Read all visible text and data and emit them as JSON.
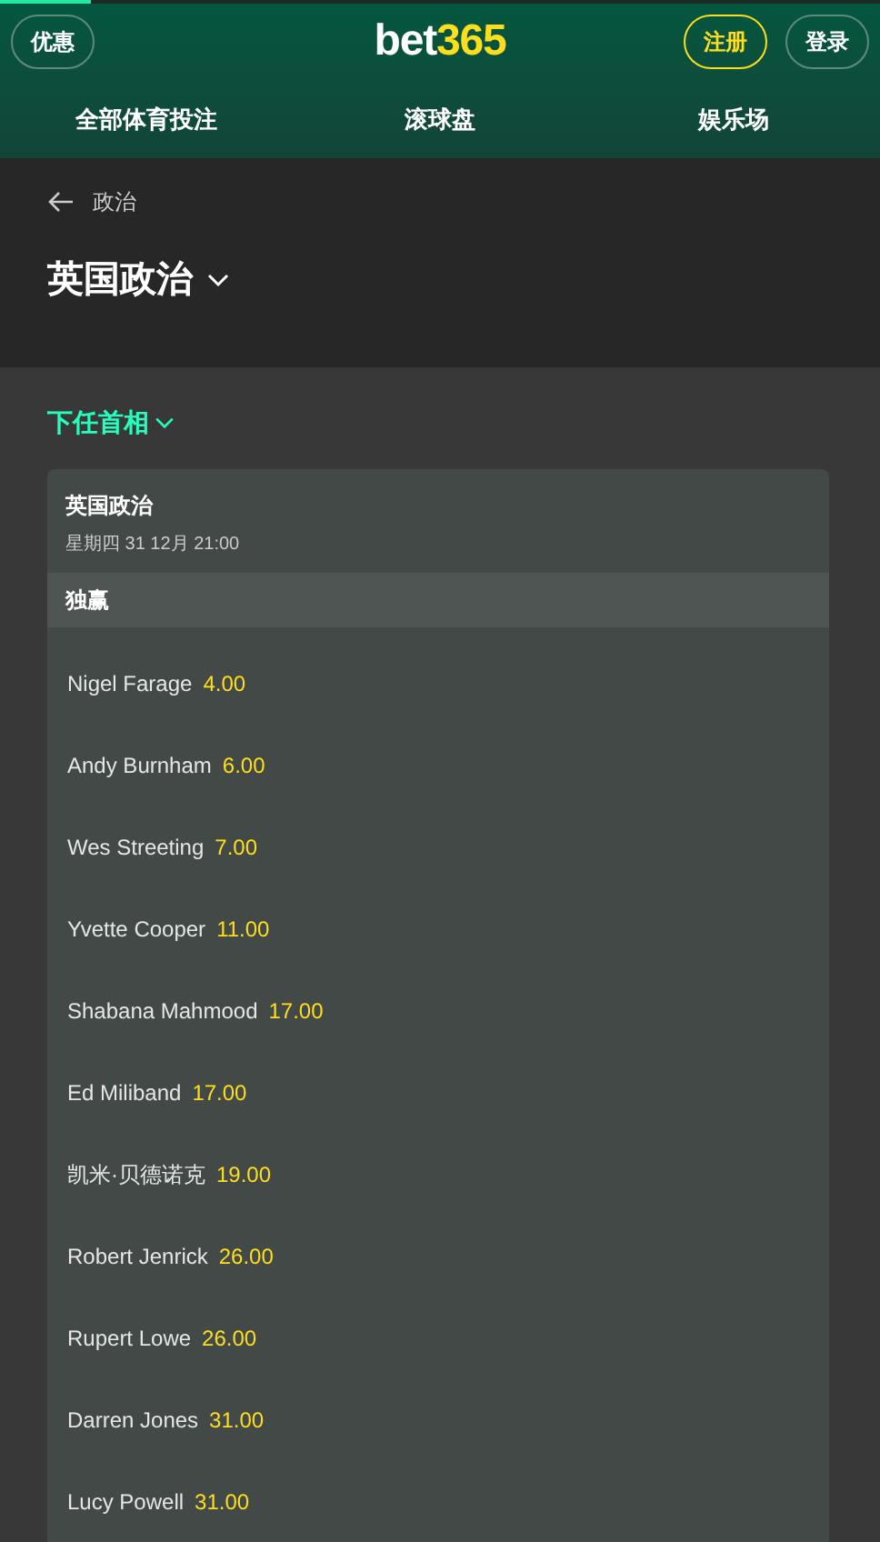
{
  "header": {
    "promo_button": "优惠",
    "logo": {
      "part_1": "bet",
      "part_2": "365"
    },
    "register_button": "注册",
    "login_button": "登录"
  },
  "nav": [
    {
      "label": "全部体育投注"
    },
    {
      "label": "滚球盘"
    },
    {
      "label": "娱乐场"
    }
  ],
  "breadcrumb": {
    "label": "政治"
  },
  "page_title": "英国政治",
  "market_selector": "下任首相",
  "event": {
    "title": "英国政治",
    "date": "星期四 31 12月 21:00",
    "market": "独赢",
    "selections": [
      {
        "name": "Nigel Farage",
        "odds": "4.00"
      },
      {
        "name": "Andy Burnham",
        "odds": "6.00"
      },
      {
        "name": "Wes Streeting",
        "odds": "7.00"
      },
      {
        "name": "Yvette Cooper",
        "odds": "11.00"
      },
      {
        "name": "Shabana Mahmood",
        "odds": "17.00"
      },
      {
        "name": "Ed Miliband",
        "odds": "17.00"
      },
      {
        "name": "凯米·贝德诺克",
        "odds": "19.00"
      },
      {
        "name": "Robert Jenrick",
        "odds": "26.00"
      },
      {
        "name": "Rupert Lowe",
        "odds": "26.00"
      },
      {
        "name": "Darren Jones",
        "odds": "31.00"
      },
      {
        "name": "Lucy Powell",
        "odds": "31.00"
      }
    ]
  }
}
